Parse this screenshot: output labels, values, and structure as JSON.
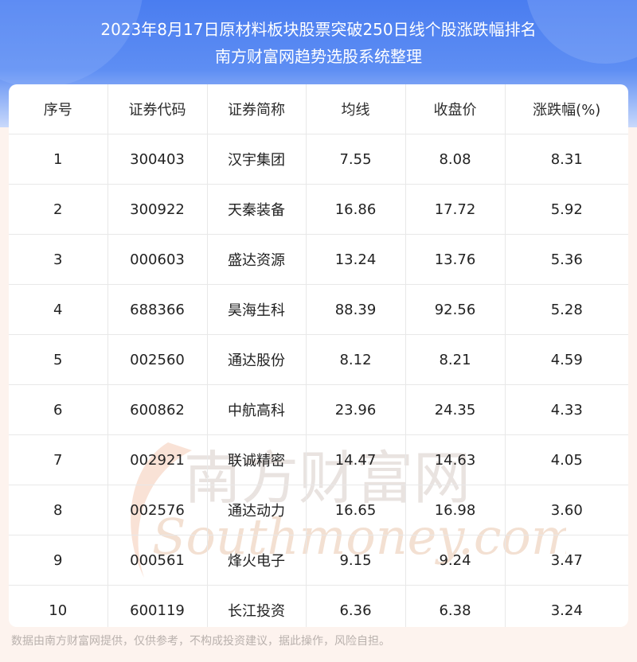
{
  "header": {
    "title": "2023年8月17日原材料板块股票突破250日线个股涨跌幅排名",
    "subtitle": "南方财富网趋势选股系统整理"
  },
  "table": {
    "columns": [
      "序号",
      "证券代码",
      "证券简称",
      "均线",
      "收盘价",
      "涨跌幅(%)"
    ],
    "rows": [
      [
        "1",
        "300403",
        "汉宇集团",
        "7.55",
        "8.08",
        "8.31"
      ],
      [
        "2",
        "300922",
        "天秦装备",
        "16.86",
        "17.72",
        "5.92"
      ],
      [
        "3",
        "000603",
        "盛达资源",
        "13.24",
        "13.76",
        "5.36"
      ],
      [
        "4",
        "688366",
        "昊海生科",
        "88.39",
        "92.56",
        "5.28"
      ],
      [
        "5",
        "002560",
        "通达股份",
        "8.12",
        "8.21",
        "4.59"
      ],
      [
        "6",
        "600862",
        "中航高科",
        "23.96",
        "24.35",
        "4.33"
      ],
      [
        "7",
        "002921",
        "联诚精密",
        "14.47",
        "14.63",
        "4.05"
      ],
      [
        "8",
        "002576",
        "通达动力",
        "16.65",
        "16.98",
        "3.60"
      ],
      [
        "9",
        "000561",
        "烽火电子",
        "9.15",
        "9.24",
        "3.47"
      ],
      [
        "10",
        "600119",
        "长江投资",
        "6.36",
        "6.38",
        "3.24"
      ]
    ]
  },
  "watermark": {
    "cn": "南方财富网",
    "en": "Southmoney.com"
  },
  "footer": {
    "disclaimer": "数据由南方财富网提供，仅供参考，不构成投资建议，据此操作，风险自担。"
  }
}
